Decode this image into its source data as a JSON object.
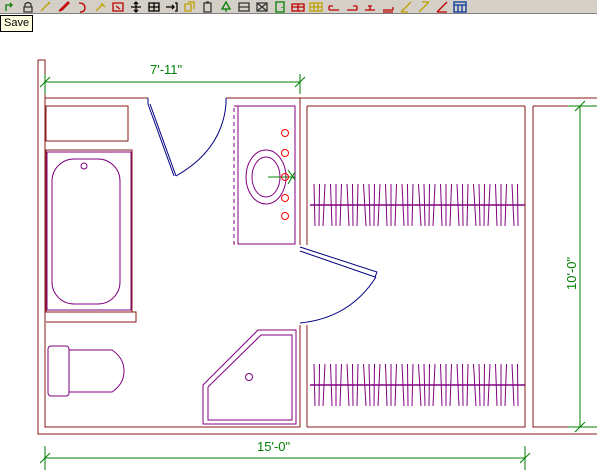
{
  "toolbar": {
    "buttons": [
      {
        "icon": "undo-icon",
        "color": "#008000"
      },
      {
        "icon": "lock-icon",
        "color": "#333333"
      },
      {
        "icon": "wand-icon",
        "color": "#c0a000"
      },
      {
        "icon": "pencil-icon",
        "color": "#c00000"
      },
      {
        "icon": "arc-icon",
        "color": "#c00000"
      },
      {
        "icon": "paint-brush-icon",
        "color": "#c0a000"
      },
      {
        "icon": "select-box-icon",
        "color": "#c00000"
      },
      {
        "icon": "move-icon",
        "color": "#000000"
      },
      {
        "icon": "grid-move-icon",
        "color": "#000000"
      },
      {
        "icon": "arrow-wall-icon",
        "color": "#000000"
      },
      {
        "icon": "copy-icon",
        "color": "#c0a000"
      },
      {
        "icon": "paste-icon",
        "color": "#333333"
      },
      {
        "icon": "tree-icon",
        "color": "#008000"
      },
      {
        "icon": "window-icon",
        "color": "#333333"
      },
      {
        "icon": "cross-window-icon",
        "color": "#333333"
      },
      {
        "icon": "door-icon",
        "color": "#008000"
      },
      {
        "icon": "cabinet-icon",
        "color": "#c00000"
      },
      {
        "icon": "grid-cabinet-icon",
        "color": "#c0a000"
      },
      {
        "icon": "wall-left-icon",
        "color": "#c00000"
      },
      {
        "icon": "wall-right-icon",
        "color": "#c00000"
      },
      {
        "icon": "wall-center-icon",
        "color": "#c00000"
      },
      {
        "icon": "wall-end-icon",
        "color": "#c00000"
      },
      {
        "icon": "diagonal-left-icon",
        "color": "#c0a000"
      },
      {
        "icon": "diagonal-right-icon",
        "color": "#c0a000"
      },
      {
        "icon": "angle-icon",
        "color": "#c00000"
      },
      {
        "icon": "table-icon",
        "color": "#003399"
      }
    ]
  },
  "tooltip": {
    "text": "Save"
  },
  "dimensions": {
    "top_width": "7'-11\"",
    "bottom_width": "15'-0\"",
    "right_height": "10'-0\""
  },
  "colors": {
    "wall": "#8b1a1a",
    "fixture": "#800080",
    "dimension": "#007f00",
    "door": "#000080",
    "faucet": "#ff0000"
  }
}
